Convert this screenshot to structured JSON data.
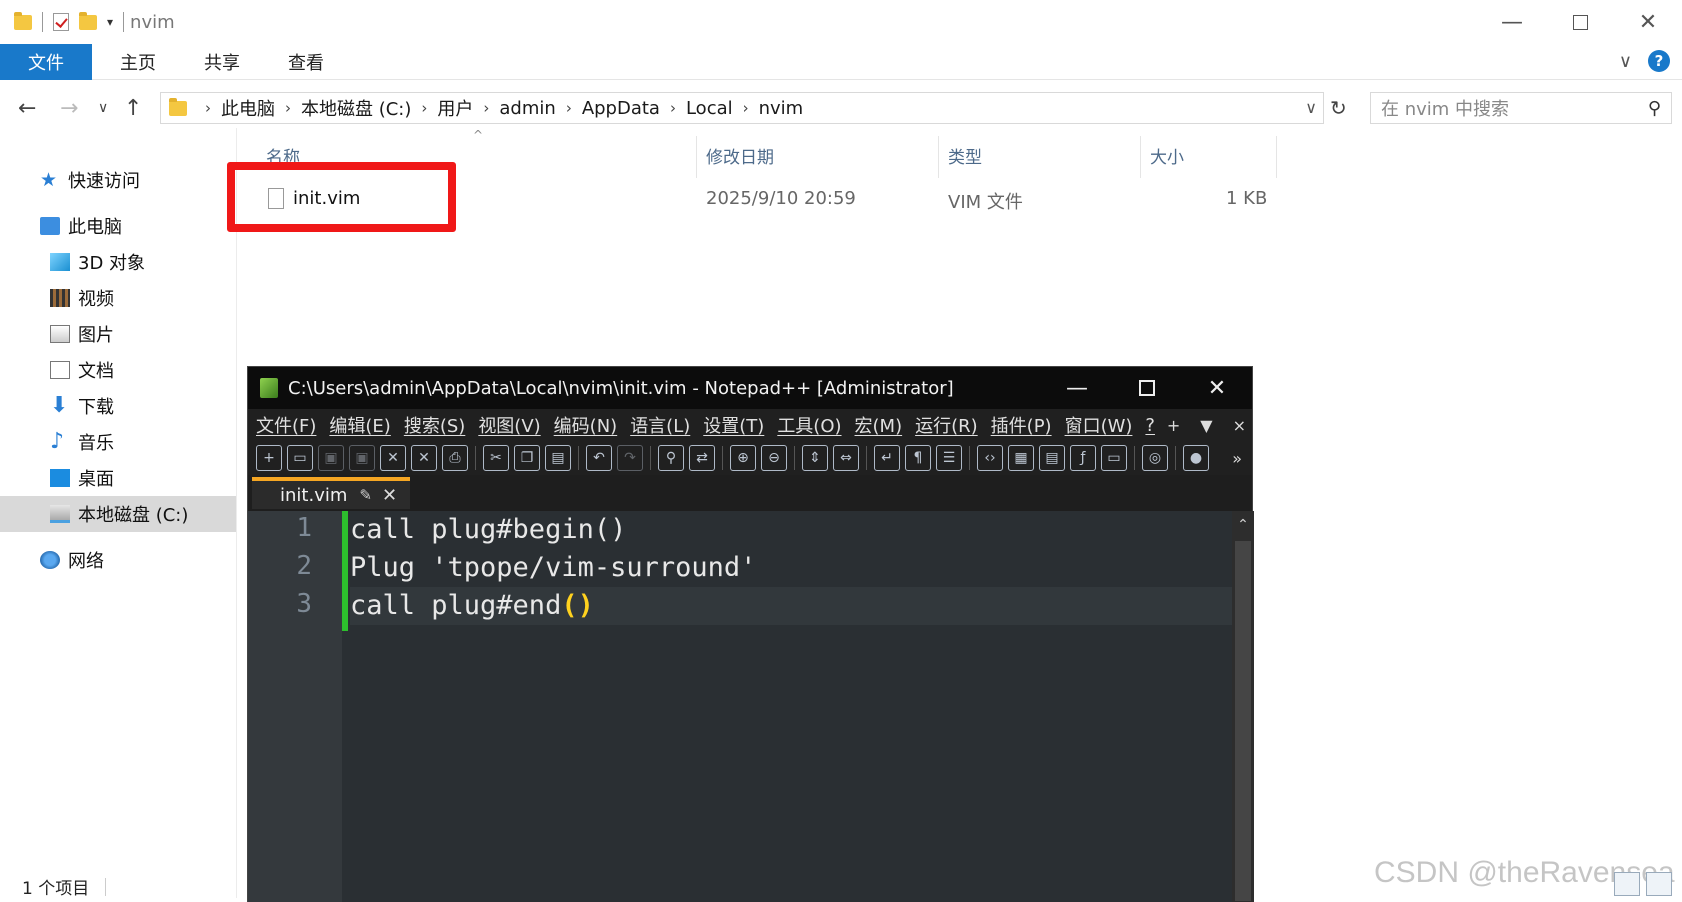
{
  "explorer": {
    "title": "nvim",
    "ribbon_tabs": [
      "文件",
      "主页",
      "共享",
      "查看"
    ],
    "breadcrumbs": [
      "此电脑",
      "本地磁盘 (C:)",
      "用户",
      "admin",
      "AppData",
      "Local",
      "nvim"
    ],
    "search_placeholder": "在 nvim 中搜索",
    "sidebar": {
      "quick_access": "快速访问",
      "this_pc": "此电脑",
      "items": [
        "3D 对象",
        "视频",
        "图片",
        "文档",
        "下载",
        "音乐",
        "桌面",
        "本地磁盘 (C:)"
      ],
      "network": "网络"
    },
    "columns": {
      "name": "名称",
      "modified": "修改日期",
      "type": "类型",
      "size": "大小"
    },
    "files": [
      {
        "name": "init.vim",
        "modified": "2025/9/10 20:59",
        "type": "VIM 文件",
        "size": "1 KB"
      }
    ],
    "status": "1 个项目",
    "highlight_color": "#f01818",
    "accent_color": "#1979ca"
  },
  "notepad": {
    "title": "C:\\Users\\admin\\AppData\\Local\\nvim\\init.vim - Notepad++ [Administrator]",
    "menu": [
      "文件(F)",
      "编辑(E)",
      "搜索(S)",
      "视图(V)",
      "编码(N)",
      "语言(L)",
      "设置(T)",
      "工具(O)",
      "宏(M)",
      "运行(R)",
      "插件(P)",
      "窗口(W)",
      "?"
    ],
    "menu_right": [
      "+",
      "▼",
      "×"
    ],
    "tab_name": "init.vim",
    "lines": [
      {
        "number": "1",
        "text": "call plug#begin()"
      },
      {
        "number": "2",
        "text": "Plug 'tpope/vim-surround'"
      },
      {
        "number": "3",
        "text": "call plug#end",
        "paren": "()"
      }
    ]
  },
  "watermark": "CSDN @theRavensea"
}
